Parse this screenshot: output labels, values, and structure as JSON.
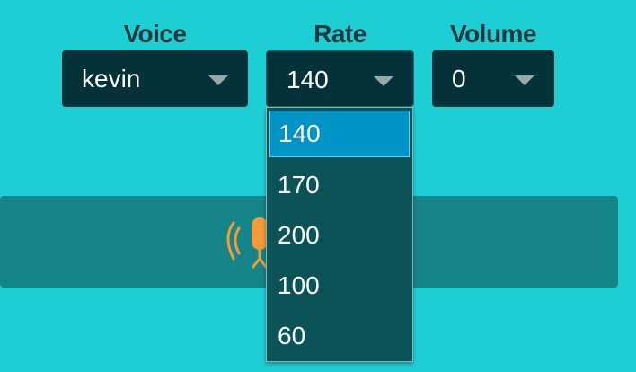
{
  "controls": {
    "voice": {
      "label": "Voice",
      "value": "kevin"
    },
    "rate": {
      "label": "Rate",
      "value": "140",
      "options": [
        "140",
        "170",
        "200",
        "100",
        "60"
      ]
    },
    "volume": {
      "label": "Volume",
      "value": "0"
    }
  },
  "icons": {
    "speaker": "microphone-broadcast-icon",
    "dropdown": "chevron-down-icon"
  },
  "colors": {
    "background": "#1dcfd5",
    "select_bg": "#053238",
    "panel": "#168589",
    "accent": "#f39a3a",
    "highlight": "#0093c6"
  }
}
